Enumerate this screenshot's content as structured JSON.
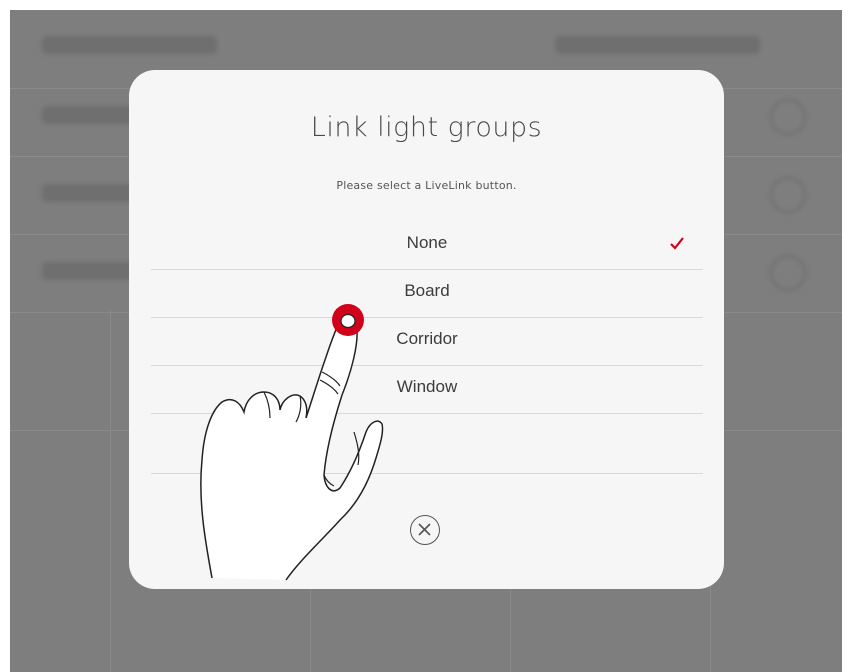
{
  "dialog": {
    "title": "Link light groups",
    "subtitle": "Please select a LiveLink button.",
    "options": [
      {
        "label": "None",
        "selected": true
      },
      {
        "label": "Board",
        "selected": false
      },
      {
        "label": "Corridor",
        "selected": false
      },
      {
        "label": "Window",
        "selected": false
      },
      {
        "label": "",
        "selected": false
      }
    ],
    "close_icon": "close-circle-icon"
  },
  "colors": {
    "overlay": "#7e7e7e",
    "dialog_bg": "#f6f6f6",
    "check_mark": "#d0021b",
    "tap_indicator": "#d0021b"
  },
  "tutorial": {
    "hand_icon": "pointing-hand-icon",
    "tap_indicator_icon": "tap-indicator-icon"
  }
}
